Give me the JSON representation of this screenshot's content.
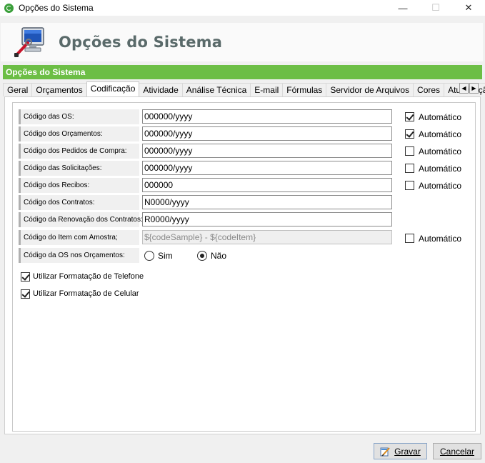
{
  "window": {
    "title": "Opções do Sistema",
    "minimize_glyph": "—",
    "maximize_glyph": "☐",
    "close_glyph": "✕"
  },
  "header": {
    "title": "Opções do Sistema",
    "icon": "computer-settings-icon"
  },
  "section_bar": {
    "label": "Opções do Sistema"
  },
  "tabs": [
    {
      "label": "Geral",
      "active": false
    },
    {
      "label": "Orçamentos",
      "active": false
    },
    {
      "label": "Codificação",
      "active": true
    },
    {
      "label": "Atividade",
      "active": false
    },
    {
      "label": "Análise Técnica",
      "active": false
    },
    {
      "label": "E-mail",
      "active": false
    },
    {
      "label": "Fórmulas",
      "active": false
    },
    {
      "label": "Servidor de Arquivos",
      "active": false
    },
    {
      "label": "Cores",
      "active": false
    },
    {
      "label": "Atualização",
      "active": false
    }
  ],
  "tab_scroll": {
    "left": "◀",
    "right": "▶"
  },
  "fields": [
    {
      "label": "Código das OS:",
      "value": "000000/yyyy",
      "auto": true,
      "auto_label": "Automático"
    },
    {
      "label": "Código dos Orçamentos:",
      "value": "000000/yyyy",
      "auto": true,
      "auto_label": "Automático"
    },
    {
      "label": "Código dos Pedidos de Compra:",
      "value": "000000/yyyy",
      "auto": false,
      "auto_label": "Automático"
    },
    {
      "label": "Código das Solicitações:",
      "value": "000000/yyyy",
      "auto": false,
      "auto_label": "Automático"
    },
    {
      "label": "Código dos Recibos:",
      "value": "000000",
      "auto": false,
      "auto_label": "Automático"
    },
    {
      "label": "Código dos Contratos:",
      "value": "N0000/yyyy"
    },
    {
      "label": "Código da Renovação dos Contratos:",
      "value": "R0000/yyyy"
    },
    {
      "label": "Código do Item com Amostra;",
      "value": "${codeSample} - ${codeItem}",
      "disabled": true,
      "auto": false,
      "auto_label": "Automático"
    }
  ],
  "os_orcamentos": {
    "label": "Código da OS nos Orçamentos:",
    "options": [
      {
        "label": "Sim",
        "selected": false
      },
      {
        "label": "Não",
        "selected": true
      }
    ]
  },
  "options": [
    {
      "label": "Utilizar Formatação de Telefone",
      "checked": true
    },
    {
      "label": "Utilizar Formatação de Celular",
      "checked": true
    }
  ],
  "buttons": {
    "save": "Gravar",
    "cancel": "Cancelar"
  },
  "colors": {
    "accent_green": "#6cbe45",
    "header_title": "#5a6a6a"
  }
}
